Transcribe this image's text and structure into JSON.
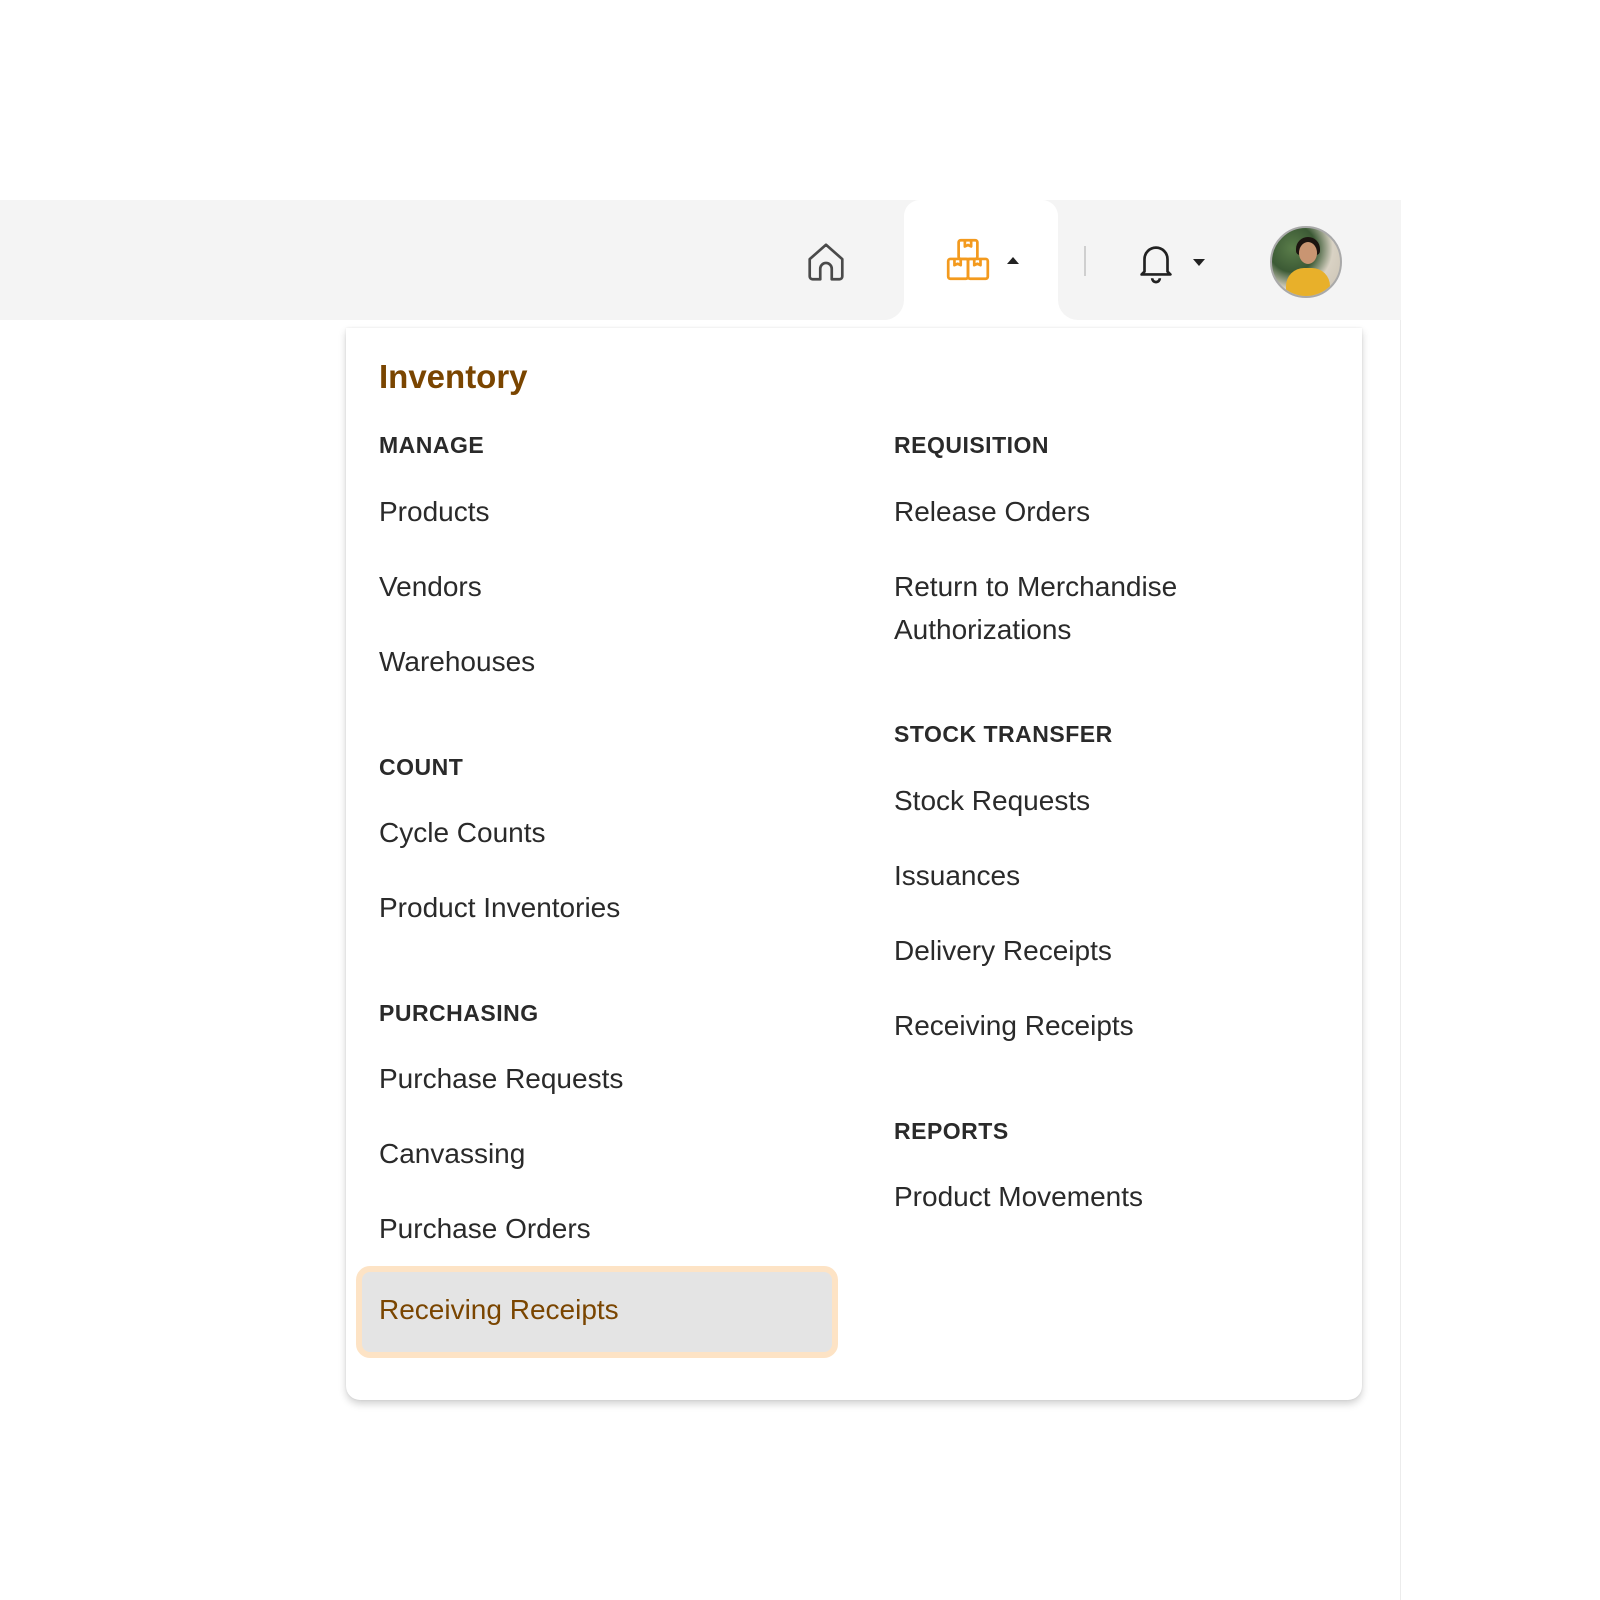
{
  "topbar": {
    "icons": {
      "home": "home-icon",
      "inventory": "boxes-icon",
      "notifications": "bell-icon",
      "avatar": "user-avatar"
    },
    "active_color": "#f39a1e"
  },
  "menu": {
    "title": "Inventory",
    "title_color": "#7a4500",
    "selected_item": "Receiving Receipts",
    "left_column": [
      {
        "heading": "MANAGE",
        "items": [
          "Products",
          "Vendors",
          "Warehouses"
        ]
      },
      {
        "heading": "COUNT",
        "items": [
          "Cycle Counts",
          "Product Inventories"
        ]
      },
      {
        "heading": "PURCHASING",
        "items": [
          "Purchase Requests",
          "Canvassing",
          "Purchase Orders",
          "Receiving Receipts"
        ]
      }
    ],
    "right_column": [
      {
        "heading": "REQUISITION",
        "items": [
          "Release Orders",
          "Return to Merchandise Authorizations"
        ]
      },
      {
        "heading": "STOCK TRANSFER",
        "items": [
          "Stock Requests",
          "Issuances",
          "Delivery Receipts",
          "Receiving Receipts"
        ]
      },
      {
        "heading": "REPORTS",
        "items": [
          "Product Movements"
        ]
      }
    ]
  }
}
